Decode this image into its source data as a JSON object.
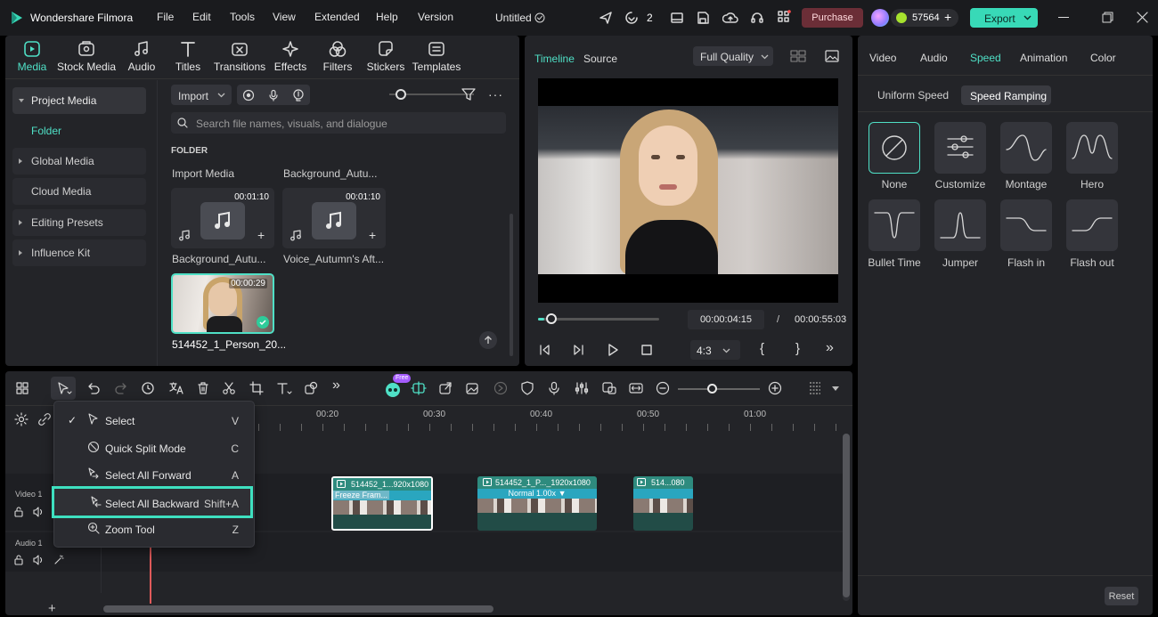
{
  "app": {
    "title": "Wondershare Filmora",
    "project": "Untitled",
    "menu": [
      "File",
      "Edit",
      "Tools",
      "View",
      "Extended",
      "Help",
      "Version"
    ],
    "collab_count": "2",
    "purchase": "Purchase",
    "credits": "57564",
    "export": "Export"
  },
  "toolbar": [
    "Media",
    "Stock Media",
    "Audio",
    "Titles",
    "Transitions",
    "Effects",
    "Filters",
    "Stickers",
    "Templates"
  ],
  "sidebar": {
    "items": [
      "Project Media",
      "Folder",
      "Global Media",
      "Cloud Media",
      "Editing Presets",
      "Influence Kit"
    ]
  },
  "media": {
    "import": "Import",
    "search_placeholder": "Search file names, visuals, and dialogue",
    "folder_label": "FOLDER",
    "import_media": "Import Media",
    "bg_auto": "Background_Autu...",
    "items": [
      {
        "name": "Background_Autu...",
        "duration": "00:01:10"
      },
      {
        "name": "Voice_Autumn's Aft...",
        "duration": "00:01:10"
      },
      {
        "name": "514452_1_Person_20...",
        "duration": "00:00:29"
      }
    ]
  },
  "player": {
    "tab_timeline": "Timeline",
    "tab_source": "Source",
    "quality": "Full Quality",
    "current_time": "00:00:04:15",
    "separator": "/",
    "total_time": "00:00:55:03",
    "ratio": "4:3",
    "progress": 0.05
  },
  "props": {
    "tabs": [
      "Video",
      "Audio",
      "Speed",
      "Animation",
      "Color"
    ],
    "active_tab": "Speed",
    "subtabs": [
      "Uniform Speed",
      "Speed Ramping"
    ],
    "active_subtab": "Speed Ramping",
    "presets": [
      "None",
      "Customize",
      "Montage",
      "Hero",
      "Bullet Time",
      "Jumper",
      "Flash in",
      "Flash out"
    ],
    "reset": "Reset"
  },
  "context_menu": {
    "items": [
      {
        "label": "Select",
        "key": "V",
        "checked": true
      },
      {
        "label": "Quick Split Mode",
        "key": "C"
      },
      {
        "label": "Select All Forward",
        "key": "A"
      },
      {
        "label": "Select All Backward",
        "key": "Shift+A",
        "highlighted": true
      },
      {
        "label": "Zoom Tool",
        "key": "Z"
      }
    ]
  },
  "timeline": {
    "ruler": [
      "00:20",
      "00:30",
      "00:40",
      "00:50",
      "01:00"
    ],
    "free_badge": "Free",
    "zoom": 0.3,
    "tracks": [
      {
        "name": "Video 1"
      },
      {
        "name": "Audio 1"
      }
    ],
    "clips": [
      {
        "title": "514452_1...920x1080",
        "label": "Freeze Fram..."
      },
      {
        "title": "514452_1_P..._1920x1080",
        "label": "Normal 1.00x"
      },
      {
        "title": "514...080",
        "label": ""
      }
    ]
  },
  "colors": {
    "accent": "#4fe0c6",
    "purchase_bg": "#6b2e37",
    "export_bg": "#38d9b7",
    "highlight": "#3ee0c0"
  }
}
